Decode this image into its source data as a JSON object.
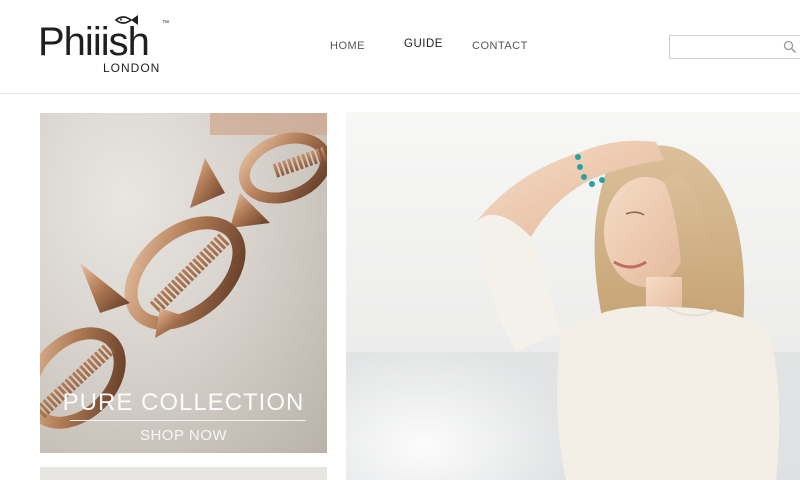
{
  "brand": {
    "name": "Phiiish",
    "tm": "™",
    "location": "LONDON"
  },
  "nav": {
    "items": [
      {
        "label": "HOME"
      },
      {
        "label": "GUIDE"
      },
      {
        "label": "CONTACT"
      }
    ],
    "active": "GUIDE"
  },
  "search": {
    "placeholder": "",
    "icon": "search-icon"
  },
  "promo": {
    "title": "PURE COLLECTION",
    "cta": "SHOP NOW"
  },
  "hero": {
    "subject": "model-photo"
  },
  "colors": {
    "text_dark": "#222222",
    "nav_text": "#555555",
    "border": "#e6e6e6",
    "gold": "#b07a55"
  }
}
